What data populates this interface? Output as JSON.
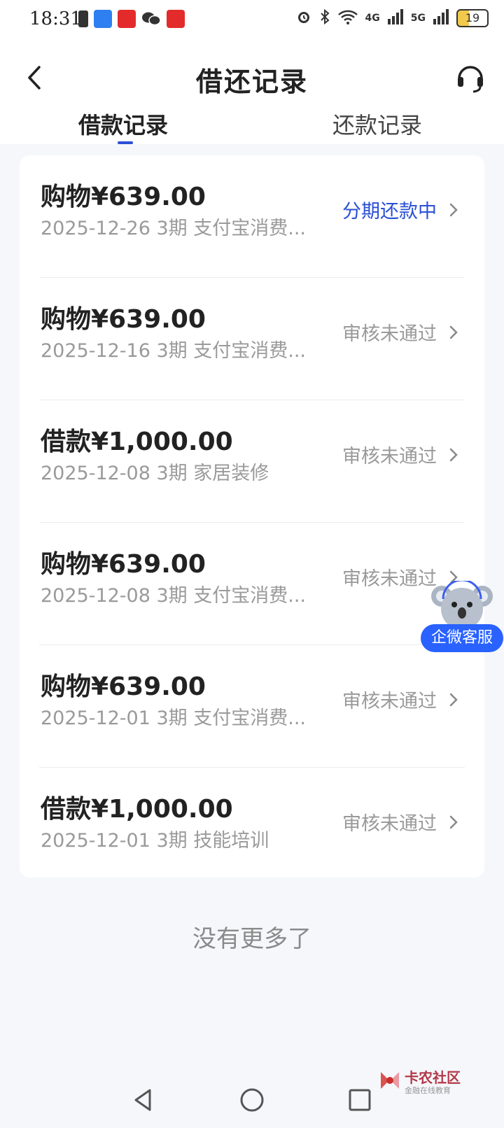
{
  "status_bar": {
    "time": "18:31",
    "net_4g": "4G",
    "net_5g": "5G",
    "battery": "19"
  },
  "header": {
    "title": "借还记录",
    "tabs": [
      {
        "label": "借款记录",
        "active": true
      },
      {
        "label": "还款记录",
        "active": false
      }
    ]
  },
  "records": [
    {
      "amount": "购物¥639.00",
      "meta": "2025-12-26 3期  支付宝消费...",
      "status": "分期还款中",
      "status_active": true
    },
    {
      "amount": "购物¥639.00",
      "meta": "2025-12-16 3期  支付宝消费...",
      "status": "审核未通过",
      "status_active": false
    },
    {
      "amount": "借款¥1,000.00",
      "meta": "2025-12-08 3期  家居装修",
      "status": "审核未通过",
      "status_active": false
    },
    {
      "amount": "购物¥639.00",
      "meta": "2025-12-08 3期  支付宝消费...",
      "status": "审核未通过",
      "status_active": false
    },
    {
      "amount": "购物¥639.00",
      "meta": "2025-12-01 3期  支付宝消费...",
      "status": "审核未通过",
      "status_active": false
    },
    {
      "amount": "借款¥1,000.00",
      "meta": "2025-12-01 3期  技能培训",
      "status": "审核未通过",
      "status_active": false
    }
  ],
  "footer": {
    "no_more": "没有更多了"
  },
  "floating_service": {
    "label": "企微客服"
  },
  "watermark": {
    "title": "卡农社区",
    "subtitle": "金融在线教育"
  },
  "colors": {
    "accent": "#2a4fd6",
    "muted_text": "#9a9a9a",
    "service_pill": "#2962ff",
    "background": "#f6f7fb"
  },
  "icons": {
    "back": "chevron-left-icon",
    "support": "headset-icon",
    "row_chevron": "chevron-right-icon",
    "nav": [
      "triangle-back-icon",
      "circle-home-icon",
      "square-recents-icon"
    ]
  }
}
